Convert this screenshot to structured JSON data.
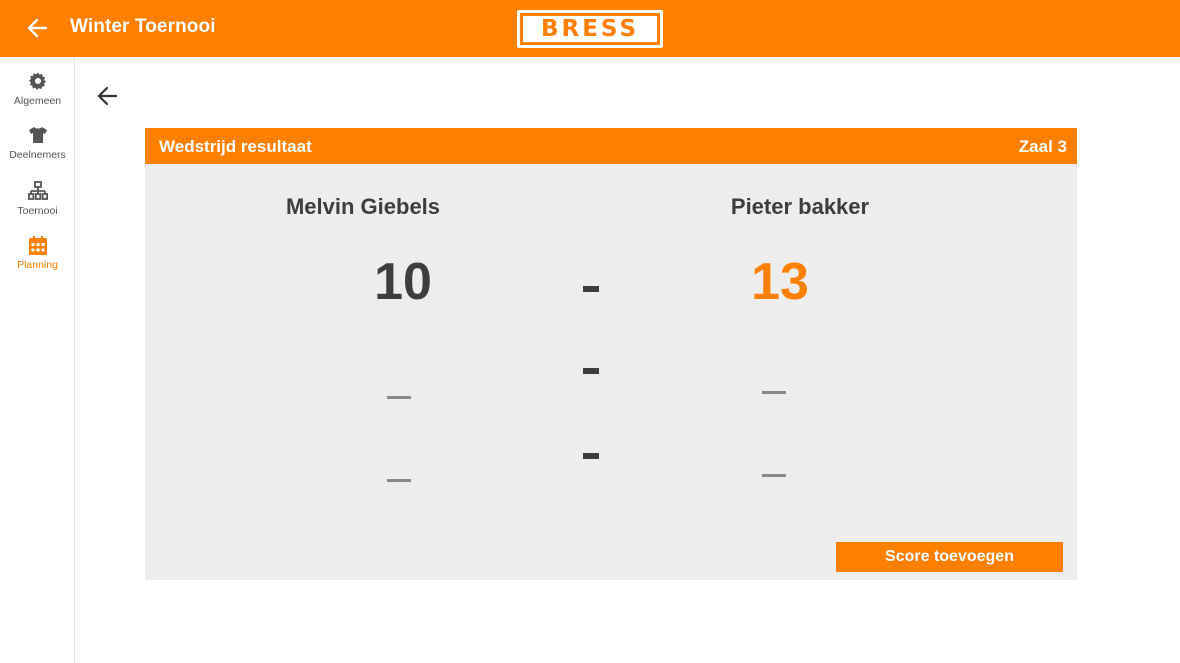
{
  "app": {
    "title": "Winter Toernooi",
    "logo_text": "BRESS",
    "brand_color": "#ff7f00"
  },
  "sidebar": {
    "items": [
      {
        "label": "Algemeen",
        "icon": "gear-icon",
        "active": false
      },
      {
        "label": "Deelnemers",
        "icon": "tshirt-icon",
        "active": false
      },
      {
        "label": "Toernooi",
        "icon": "bracket-icon",
        "active": false
      },
      {
        "label": "Planning",
        "icon": "calendar-icon",
        "active": true
      }
    ]
  },
  "match": {
    "header_title": "Wedstrijd resultaat",
    "court": "Zaal 3",
    "player1": "Melvin Giebels",
    "player2": "Pieter bakker",
    "games": [
      {
        "p1": "10",
        "p2": "13",
        "winner": "p2"
      },
      {
        "p1": null,
        "p2": null
      },
      {
        "p1": null,
        "p2": null
      }
    ],
    "score_color_default": "#3d3d3d",
    "score_color_winner": "#ff7f00",
    "add_score_label": "Score toevoegen"
  }
}
